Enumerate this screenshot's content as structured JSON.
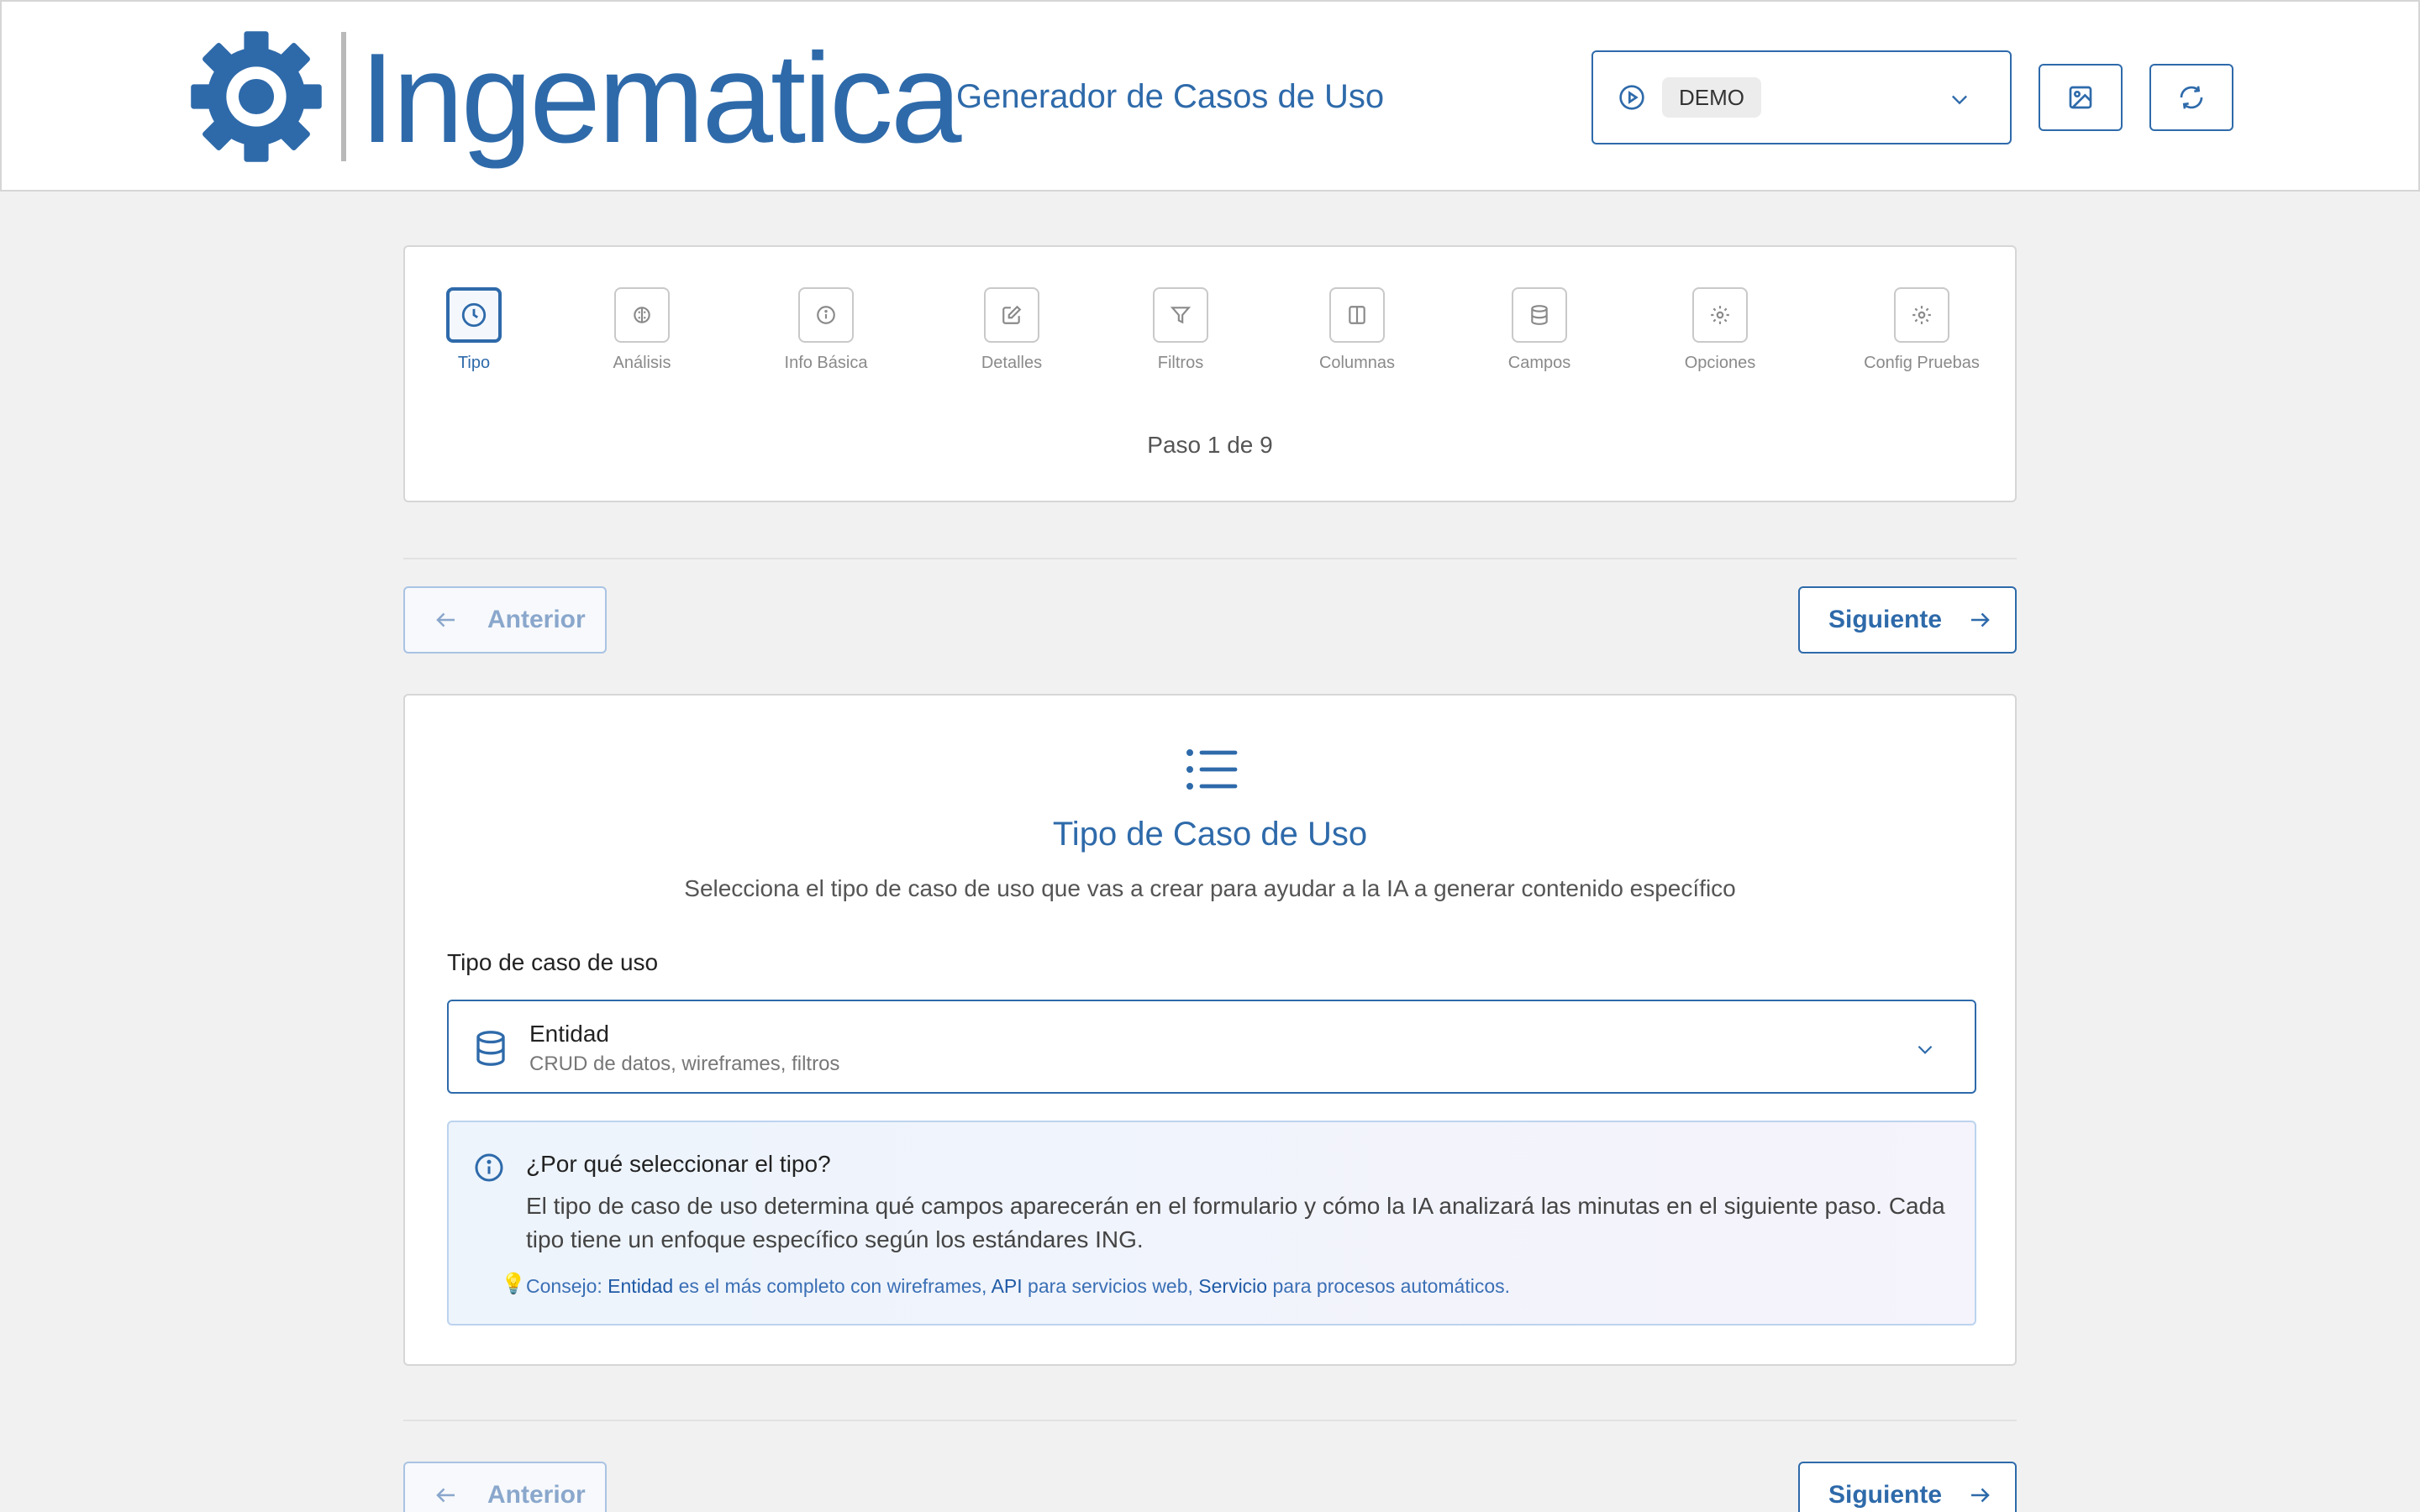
{
  "header": {
    "logo_text": "Ingematica",
    "subtitle": "Generador de Casos de Uso",
    "mode_badge": "DEMO",
    "icons": [
      "gear-logo-icon",
      "play-circle-icon",
      "chevron-down-icon",
      "image-icon",
      "refresh-icon"
    ],
    "accent_color": "#2e6aaa"
  },
  "stepper": {
    "steps": [
      {
        "label": "Tipo",
        "icon": "clock-icon",
        "active": true
      },
      {
        "label": "Análisis",
        "icon": "brain-icon",
        "active": false
      },
      {
        "label": "Info Básica",
        "icon": "info-icon",
        "active": false
      },
      {
        "label": "Detalles",
        "icon": "edit-icon",
        "active": false
      },
      {
        "label": "Filtros",
        "icon": "filter-icon",
        "active": false
      },
      {
        "label": "Columnas",
        "icon": "columns-icon",
        "active": false
      },
      {
        "label": "Campos",
        "icon": "database-icon",
        "active": false
      },
      {
        "label": "Opciones",
        "icon": "settings-icon",
        "active": false
      },
      {
        "label": "Config Pruebas",
        "icon": "settings-icon",
        "active": false
      }
    ],
    "counter": "Paso 1 de 9"
  },
  "nav": {
    "prev_label": "Anterior",
    "next_label": "Siguiente"
  },
  "main": {
    "title": "Tipo de Caso de Uso",
    "description": "Selecciona el tipo de caso de uso que vas a crear para ayudar a la IA a generar contenido específico",
    "field_label": "Tipo de caso de uso",
    "selected_type": {
      "name": "Entidad",
      "detail": "CRUD de datos, wireframes, filtros"
    },
    "info": {
      "title": "¿Por qué seleccionar el tipo?",
      "body": "El tipo de caso de uso determina qué campos aparecerán en el formulario y cómo la IA analizará las minutas en el siguiente paso. Cada tipo tiene un enfoque específico según los estándares ING.",
      "tip_prefix": "Consejo:",
      "tip_entidad": "Entidad",
      "tip_entidad_text": "es el más completo con wireframes,",
      "tip_api": "API",
      "tip_api_text": "para servicios web,",
      "tip_servicio": "Servicio",
      "tip_servicio_text": "para procesos automáticos."
    }
  }
}
